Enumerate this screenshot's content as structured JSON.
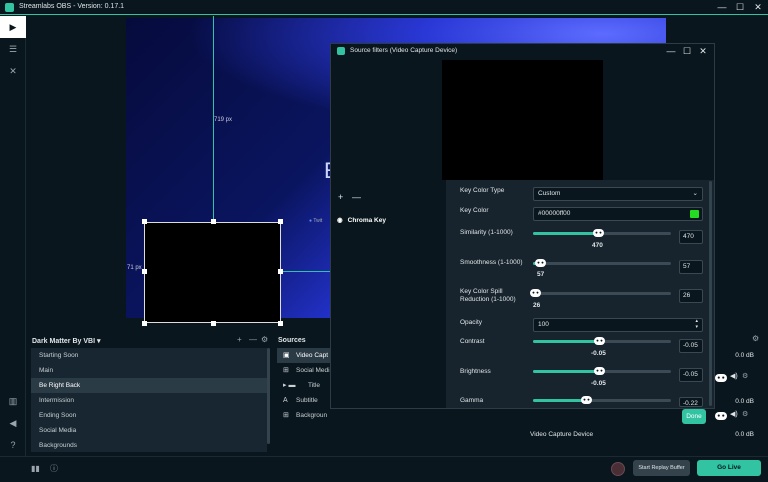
{
  "app": {
    "title": "Streamlabs OBS - Version: 0.17.1"
  },
  "window_controls": {
    "minimize": "—",
    "maximize": "☐",
    "close": "✕"
  },
  "nav": {
    "icons": [
      "studio-icon",
      "settings-sliders-icon",
      "tools-icon",
      "library-icon",
      "audio-icon",
      "help-icon",
      "settings-icon"
    ]
  },
  "preview": {
    "guide_vertical_label": "719 px",
    "guide_horizontal_label": "71 px",
    "stream_text": "E",
    "tag_text": "Twit"
  },
  "scenes": {
    "collection": "Dark Matter By VBI",
    "header_icons": [
      "+",
      "—",
      "⚙"
    ],
    "items": [
      {
        "label": "Starting Soon",
        "selected": false
      },
      {
        "label": "Main",
        "selected": false
      },
      {
        "label": "Be Right Back",
        "selected": true
      },
      {
        "label": "Intermission",
        "selected": false
      },
      {
        "label": "Ending Soon",
        "selected": false
      },
      {
        "label": "Social Media",
        "selected": false
      },
      {
        "label": "Backgrounds",
        "selected": false
      }
    ]
  },
  "sources": {
    "title": "Sources",
    "items": [
      {
        "label": "Video Capt",
        "icon": "▣",
        "selected": true
      },
      {
        "label": "Social Medi",
        "icon": "⊞",
        "selected": false
      },
      {
        "label": "Title",
        "icon": "▸ ▬",
        "selected": false
      },
      {
        "label": "Subtitle",
        "icon": "A",
        "selected": false
      },
      {
        "label": "Backgroun",
        "icon": "⊞",
        "selected": false
      }
    ]
  },
  "mixer": {
    "rows": [
      {
        "name": "",
        "db": "0.0 dB"
      },
      {
        "name": "",
        "db": "0.0 dB"
      },
      {
        "name": "Video Capture Device",
        "db": "0.0 dB"
      }
    ]
  },
  "bottom": {
    "replay": "Start Replay Buffer",
    "golive": "Go Live"
  },
  "dialog": {
    "title": "Source filters (Video Capture Device)",
    "add": "+",
    "remove": "—",
    "filter_name": "Chroma Key",
    "key_color_type_label": "Key Color Type",
    "key_color_type_value": "Custom",
    "key_color_label": "Key Color",
    "key_color_value": "#00000ff00",
    "key_color_swatch": "#22dd22",
    "similarity_label": "Similarity (1-1000)",
    "similarity_value": "470",
    "smoothness_label": "Smoothness (1-1000)",
    "smoothness_value": "57",
    "spill_label_1": "Key Color Spill",
    "spill_label_2": "Reduction (1-1000)",
    "spill_value": "26",
    "opacity_label": "Opacity",
    "opacity_value": "100",
    "contrast_label": "Contrast",
    "contrast_value": "-0.05",
    "brightness_label": "Brightness",
    "brightness_value": "-0.05",
    "gamma_label": "Gamma",
    "gamma_value": "-0.22",
    "done": "Done"
  },
  "colors": {
    "accent": "#31c3a2",
    "background": "#09161d",
    "panel": "#17242d"
  }
}
